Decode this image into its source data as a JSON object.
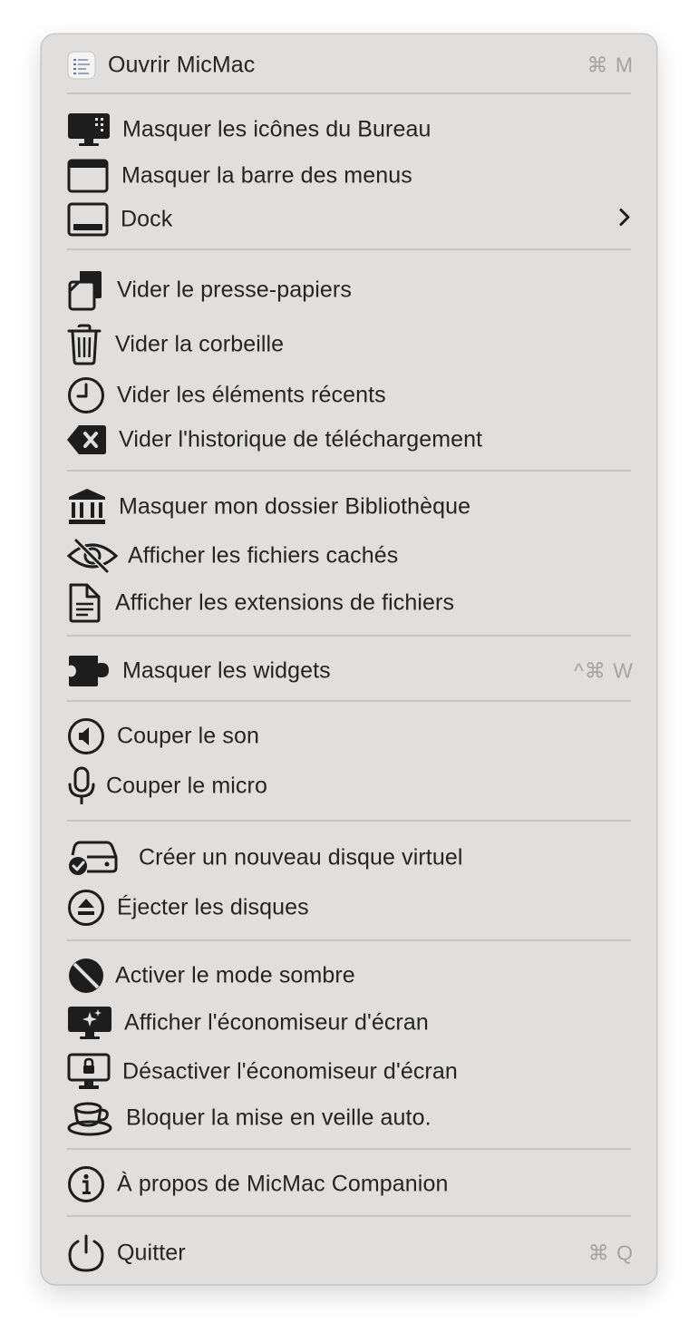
{
  "menu": {
    "open_app": {
      "label": "Ouvrir MicMac",
      "shortcut": "⌘ M",
      "icon": "app-icon"
    },
    "hide_desktop_icons": {
      "label": "Masquer les icônes du Bureau",
      "icon": "desktop-icon"
    },
    "hide_menu_bar": {
      "label": "Masquer la barre des menus",
      "icon": "window-icon"
    },
    "dock": {
      "label": "Dock",
      "icon": "dock-icon",
      "submenu_glyph": "chevron-right-icon"
    },
    "clear_clipboard": {
      "label": "Vider le presse-papiers",
      "icon": "clipboard-icon"
    },
    "empty_trash": {
      "label": "Vider la corbeille",
      "icon": "trash-icon"
    },
    "clear_recents": {
      "label": "Vider les éléments récents",
      "icon": "clock-icon"
    },
    "clear_downloads": {
      "label": "Vider l'historique de téléchargement",
      "icon": "delete-key-icon"
    },
    "hide_library": {
      "label": "Masquer mon dossier Bibliothèque",
      "icon": "bank-icon"
    },
    "show_hidden_files": {
      "label": "Afficher les fichiers cachés",
      "icon": "eye-slash-icon"
    },
    "show_extensions": {
      "label": "Afficher les extensions de fichiers",
      "icon": "document-icon"
    },
    "hide_widgets": {
      "label": "Masquer les widgets",
      "shortcut": "^⌘ W",
      "icon": "puzzle-icon"
    },
    "mute_sound": {
      "label": "Couper le son",
      "icon": "speaker-icon"
    },
    "mute_mic": {
      "label": "Couper le micro",
      "icon": "microphone-icon"
    },
    "create_virtual_disk": {
      "label": "Créer un nouveau disque virtuel",
      "icon": "disk-check-icon"
    },
    "eject_disks": {
      "label": "Éjecter les disques",
      "icon": "eject-icon"
    },
    "dark_mode": {
      "label": "Activer le mode sombre",
      "icon": "circle-slash-icon"
    },
    "show_screensaver": {
      "label": "Afficher l'économiseur d'écran",
      "icon": "screensaver-icon"
    },
    "disable_screensaver": {
      "label": "Désactiver l'économiseur d'écran",
      "icon": "screen-lock-icon"
    },
    "prevent_sleep": {
      "label": "Bloquer la mise en veille auto.",
      "icon": "cup-icon"
    },
    "about": {
      "label": "À propos de MicMac Companion",
      "icon": "info-icon"
    },
    "quit": {
      "label": "Quitter",
      "shortcut": "⌘ Q",
      "icon": "power-icon"
    }
  }
}
